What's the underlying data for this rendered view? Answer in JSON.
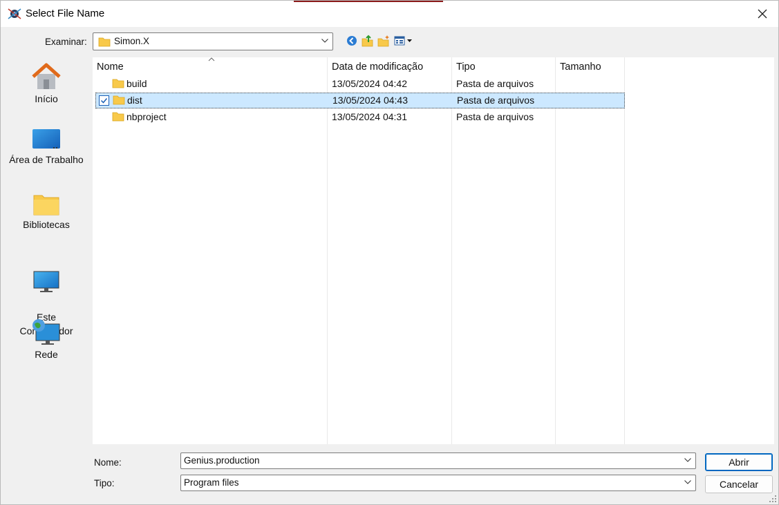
{
  "window": {
    "title": "Select File Name"
  },
  "toolbar": {
    "lookin_label": "Examinar:",
    "lookin_value": "Simon.X",
    "tools": [
      "back-icon",
      "up-folder-icon",
      "new-folder-icon",
      "view-menu-icon"
    ]
  },
  "places": [
    {
      "label": "Início",
      "icon": "home-icon"
    },
    {
      "label": "Área de Trabalho",
      "icon": "desktop-icon"
    },
    {
      "label": "Bibliotecas",
      "icon": "libraries-icon"
    },
    {
      "label": "Este\nComputador",
      "icon": "computer-icon"
    },
    {
      "label": "Rede",
      "icon": "network-icon"
    }
  ],
  "list": {
    "columns": [
      "Nome",
      "Data de modificação",
      "Tipo",
      "Tamanho"
    ],
    "rows": [
      {
        "name": "build",
        "date": "13/05/2024 04:42",
        "type": "Pasta de arquivos",
        "size": "",
        "selected": false
      },
      {
        "name": "dist",
        "date": "13/05/2024 04:43",
        "type": "Pasta de arquivos",
        "size": "",
        "selected": true
      },
      {
        "name": "nbproject",
        "date": "13/05/2024 04:31",
        "type": "Pasta de arquivos",
        "size": "",
        "selected": false
      }
    ]
  },
  "bottom": {
    "name_label": "Nome:",
    "name_value": "Genius.production",
    "type_label": "Tipo:",
    "type_value": "Program files",
    "open_label": "Abrir",
    "cancel_label": "Cancelar"
  },
  "colors": {
    "selection": "#cce8ff",
    "accent": "#0067c0",
    "folder": "#f8c94a"
  }
}
